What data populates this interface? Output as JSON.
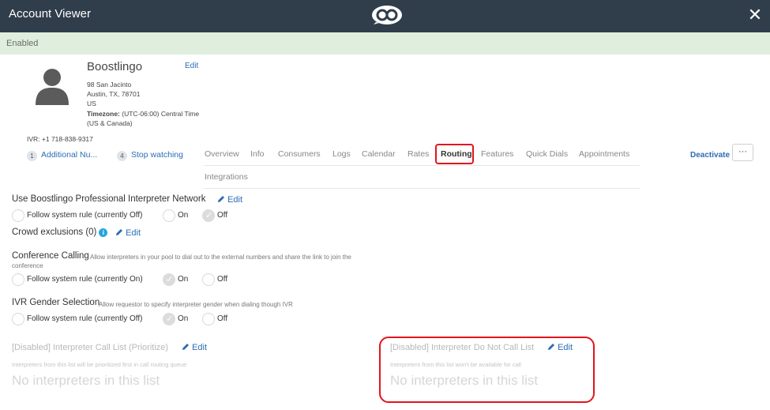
{
  "window": {
    "title": "Account Viewer",
    "logo_icon": "boostlingo-logo-icon",
    "close_icon": "close-icon",
    "close_glyph": "✕"
  },
  "status": {
    "text": "Enabled",
    "color": "#e0efdd"
  },
  "account": {
    "name": "Boostlingo",
    "edit_label": "Edit",
    "address_line1": "98 San Jacinto",
    "address_line2": "Austin, TX, 78701",
    "address_line3": "US",
    "timezone_label": "Timezone:",
    "timezone_value": "(UTC-06:00) Central Time (US & Canada)",
    "ivr": "IVR: +1 718-838-9317",
    "avatar_icon": "user-avatar-icon"
  },
  "subnav": {
    "additional_count": "1",
    "additional_label": "Additional Nu...",
    "watching_count": "4",
    "watching_label": "Stop watching"
  },
  "tabs": [
    "Overview",
    "Info",
    "Consumers",
    "Logs",
    "Calendar",
    "Rates",
    "Routing",
    "Features",
    "Quick Dials",
    "Appointments",
    "Integrations"
  ],
  "active_tab": "Routing",
  "actions": {
    "deactivate": "Deactivate",
    "more": "···"
  },
  "sections": {
    "pro_network": {
      "title": "Use Boostlingo Professional Interpreter Network",
      "edit": "Edit",
      "options": [
        "Follow system rule (currently Off)",
        "On",
        "Off"
      ],
      "selected": "Off"
    },
    "crowd": {
      "title": "Crowd exclusions (0)",
      "edit": "Edit",
      "info_glyph": "i"
    },
    "conference": {
      "title": "Conference Calling",
      "desc_line1": "Allow interpreters in your pool to dial out to the external numbers and share the link to join the",
      "desc_line2": "conference",
      "options": [
        "Follow system rule (currently On)",
        "On",
        "Off"
      ],
      "selected": "On"
    },
    "ivr_gender": {
      "title": "IVR Gender Selection",
      "desc": "Allow requestor to specify interpreter gender when dialing though IVR",
      "options": [
        "Follow system rule (currently Off)",
        "On",
        "Off"
      ],
      "selected": "On"
    },
    "call_list": {
      "title": "[Disabled] Interpreter Call List (Prioritize)",
      "edit": "Edit",
      "desc": "Interpreters from this list will be prioritized first in call routing queue",
      "empty": "No interpreters in this list"
    },
    "do_not_call": {
      "title": "[Disabled] Interpreter Do Not Call List",
      "edit": "Edit",
      "desc": "Interpreters from this list won't be available for call",
      "empty": "No interpreters in this list"
    }
  },
  "colors": {
    "header_bg": "#303d4b",
    "link": "#2a6db5",
    "highlight": "#e3141c",
    "info": "#26a5de"
  }
}
